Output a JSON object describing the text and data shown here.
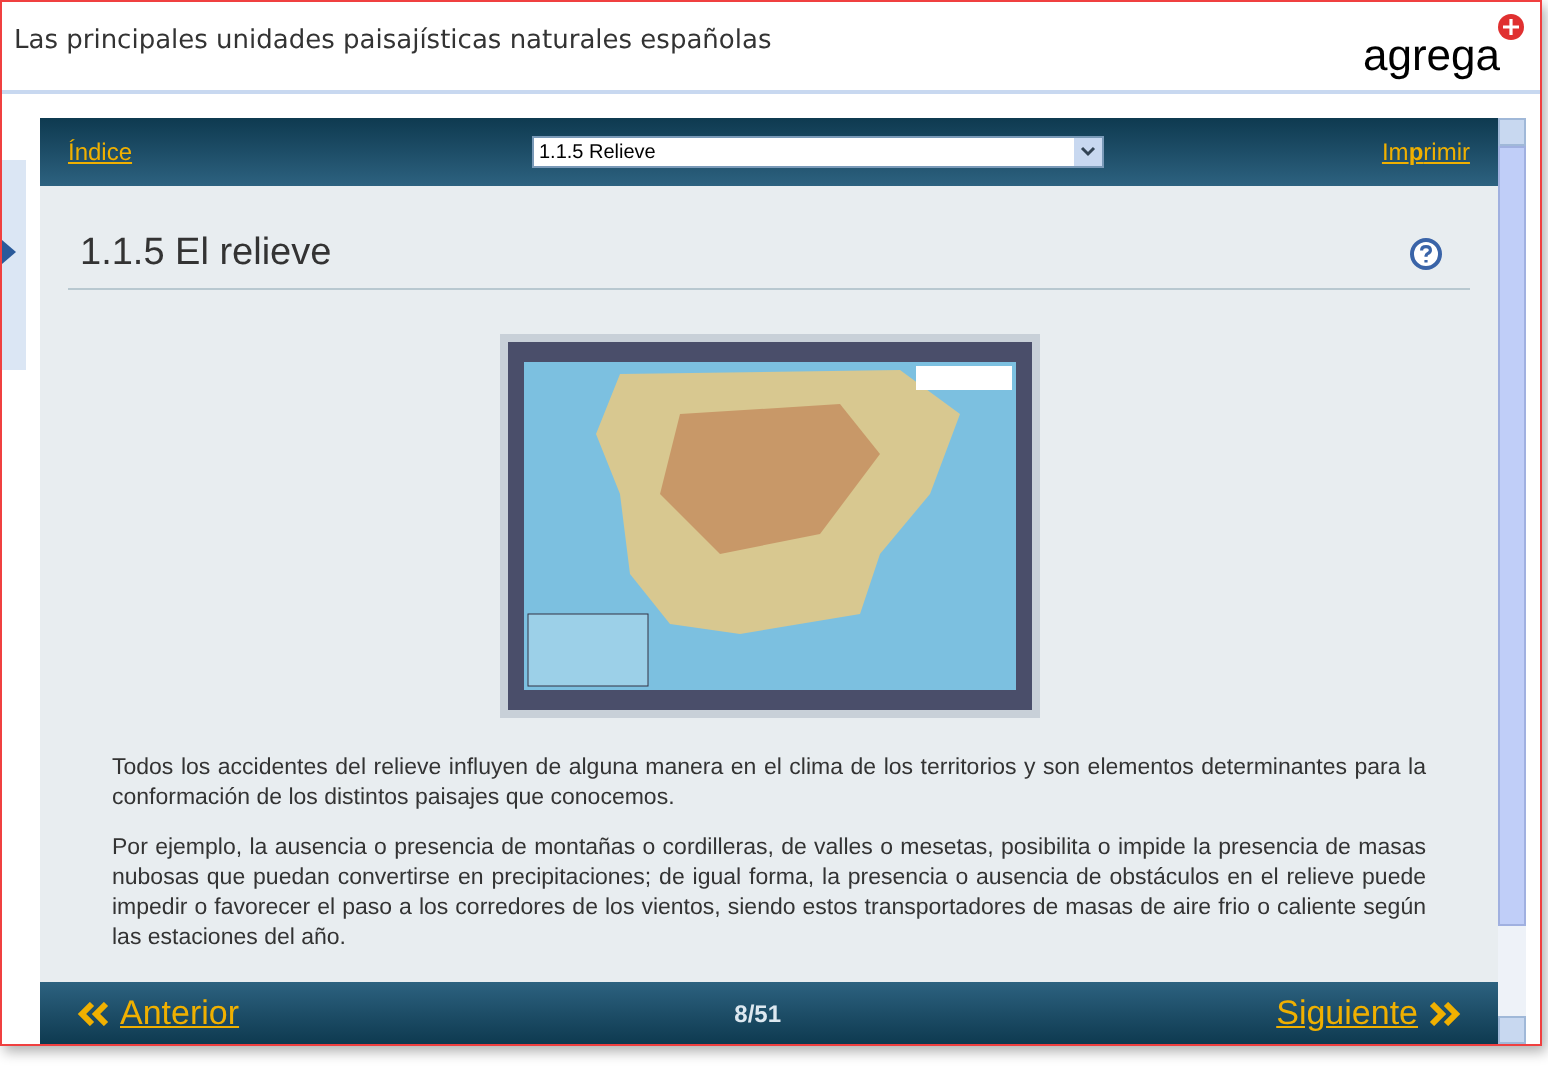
{
  "window": {
    "title": "Las principales unidades paisajísticas naturales españolas",
    "logo": "agrega"
  },
  "toolbar": {
    "index_link": "Índice",
    "section_select": {
      "value": "1.1.5 Relieve"
    },
    "print_link": "Im**p**rimir"
  },
  "section": {
    "heading": "1.1.5 El relieve"
  },
  "paragraphs": [
    "Todos los accidentes del relieve influyen de alguna manera en el clima de los territorios y son elementos determinantes para la conformación de los distintos paisajes que conocemos.",
    "Por ejemplo, la ausencia o presencia de montañas o cordilleras, de valles o mesetas, posibilita o impide la presencia de masas nubosas que puedan convertirse en precipitaciones; de igual forma, la presencia o ausencia de obstáculos en el relieve puede impedir o favorecer el paso a los corredores de los vientos, siendo estos transportadores de masas de aire frio o caliente según las estaciones del año."
  ],
  "footer": {
    "previous": "Anterior",
    "page": "8/51",
    "next": "Siguiente"
  }
}
